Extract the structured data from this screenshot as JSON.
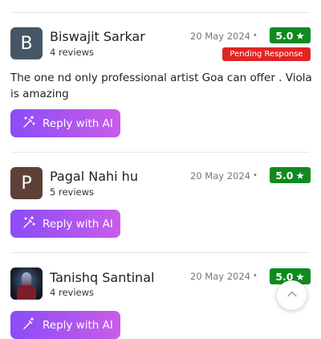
{
  "reviews": [
    {
      "avatar_letter": "B",
      "avatar_color": "#455766",
      "name": "Biswajit Sarkar",
      "review_count": "4 reviews",
      "date": "20 May 2024",
      "separator": "•",
      "rating": "5.0",
      "star": "★",
      "status": "Pending Response",
      "comment": "The one nd only professional artist Goa can offer . Viola is amazing",
      "reply_label": "Reply with AI"
    },
    {
      "avatar_letter": "P",
      "avatar_color": "#5d4037",
      "name": "Pagal Nahi hu",
      "review_count": "5 reviews",
      "date": "20 May 2024",
      "separator": "•",
      "rating": "5.0",
      "star": "★",
      "reply_label": "Reply with AI"
    },
    {
      "avatar_icon": "profile-photo",
      "name": "Tanishq Santinal",
      "review_count": "4 reviews",
      "date": "20 May 2024",
      "separator": "•",
      "rating": "5.0",
      "star": "★",
      "reply_label": "Reply with AI"
    }
  ],
  "colors": {
    "rating_badge": "#0f8a1f",
    "pending_badge": "#e02424",
    "button_gradient_start": "#8b4cf7",
    "button_gradient_end": "#c85de8"
  },
  "icons": {
    "reply_button": "magic-wand-icon",
    "floating_button": "chevron-up-icon"
  }
}
